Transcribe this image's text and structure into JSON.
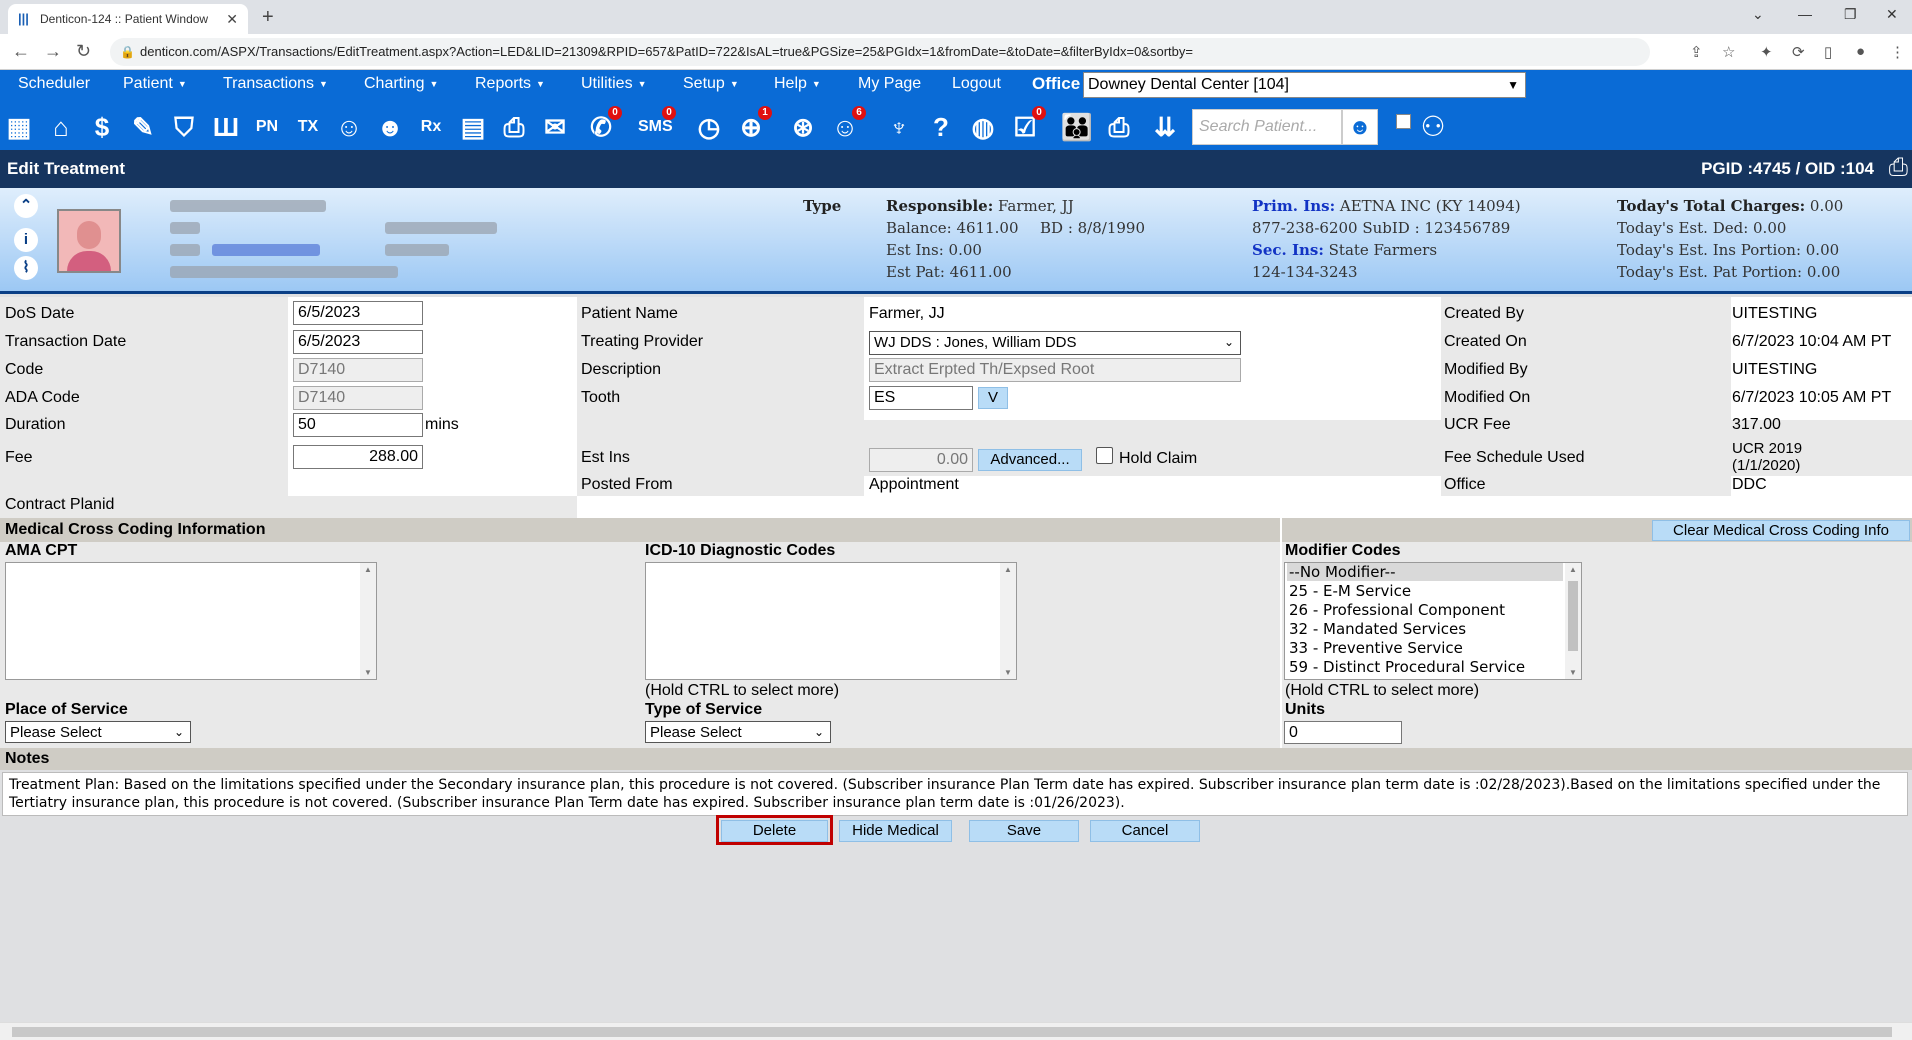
{
  "browser": {
    "tab_title": "Denticon-124 :: Patient Window",
    "url": "denticon.com/ASPX/Transactions/EditTreatment.aspx?Action=LED&LID=21309&RPID=657&PatID=722&IsAL=true&PGSize=25&PGIdx=1&fromDate=&toDate=&filterByIdx=0&sortby="
  },
  "menu": {
    "items": [
      "Scheduler",
      "Patient",
      "Transactions",
      "Charting",
      "Reports",
      "Utilities",
      "Setup",
      "Help",
      "My Page",
      "Logout"
    ],
    "office_label": "Office",
    "office_value": "Downey Dental Center [104]"
  },
  "toolbar": {
    "labels": {
      "pn": "PN",
      "tx": "TX",
      "rx": "Rx",
      "sms": "SMS"
    },
    "badges": {
      "messages": "0",
      "sms": "0",
      "alerts": "1",
      "referral": "6",
      "checklist": "0"
    },
    "search_placeholder": "Search Patient..."
  },
  "titlebar": {
    "title": "Edit Treatment",
    "ids": "PGID :4745  /  OID :104"
  },
  "banner": {
    "type_label": "Type",
    "responsible_label": "Responsible:",
    "responsible": "Farmer, JJ",
    "balance": "Balance: 4611.00",
    "bd": "BD : 8/8/1990",
    "est_ins": "Est Ins:  0.00",
    "est_pat": "Est Pat: 4611.00",
    "prim_ins_label": "Prim. Ins:",
    "prim_ins": "AETNA INC (KY 14094)",
    "prim_phone": "877-238-6200 SubID : 123456789",
    "sec_ins_label": "Sec. Ins:",
    "sec_ins": "State Farmers",
    "sec_phone": "124-134-3243",
    "total_charges_label": "Today's Total Charges:",
    "total_charges": "0.00",
    "est_ded": " Today's Est. Ded:   0.00",
    "est_ins_portion": "Today's Est. Ins Portion: 0.00",
    "est_pat_portion": "Today's Est. Pat Portion: 0.00"
  },
  "form": {
    "dos_date_label": "DoS Date",
    "dos_date": "6/5/2023",
    "transaction_date_label": "Transaction Date",
    "transaction_date": "6/5/2023",
    "code_label": "Code",
    "code": "D7140",
    "ada_code_label": "ADA Code",
    "ada_code": "D7140",
    "duration_label": "Duration",
    "duration": "50",
    "duration_unit": "mins",
    "fee_label": "Fee",
    "fee": "288.00",
    "contract_planid_label": "Contract Planid",
    "patient_name_label": "Patient Name",
    "patient_name": "Farmer, JJ",
    "treating_provider_label": "Treating Provider",
    "treating_provider": "WJ DDS : Jones, William DDS",
    "description_label": "Description",
    "description": "Extract Erpted Th/Expsed Root",
    "tooth_label": "Tooth",
    "tooth": "ES",
    "tooth_btn": "V",
    "est_ins_label": "Est Ins",
    "est_ins": "0.00",
    "advanced_btn": "Advanced...",
    "hold_claim_label": "Hold Claim",
    "posted_from_label": "Posted From",
    "posted_from": "Appointment",
    "created_by_label": "Created By",
    "created_by": "UITESTING",
    "created_on_label": "Created On",
    "created_on": "6/7/2023 10:04 AM PT",
    "modified_by_label": "Modified By",
    "modified_by": "UITESTING",
    "modified_on_label": "Modified On",
    "modified_on": "6/7/2023 10:05 AM PT",
    "ucr_fee_label": "UCR Fee",
    "ucr_fee": "317.00",
    "fee_schedule_label": "Fee Schedule Used",
    "fee_schedule_1": "UCR 2019",
    "fee_schedule_2": "(1/1/2020)",
    "office_label": "Office",
    "office": "DDC"
  },
  "medical": {
    "section_title": "Medical Cross Coding Information",
    "clear_btn": "Clear Medical Cross Coding Info",
    "ama_cpt_label": "AMA CPT",
    "icd10_label": "ICD-10 Diagnostic Codes",
    "modifier_label": "Modifier Codes",
    "modifier_options": [
      "--No Modifier--",
      "25 - E-M Service",
      "26 - Professional Component",
      "32 - Mandated Services",
      "33 - Preventive Service",
      "59 - Distinct Procedural Service"
    ],
    "ctrl_hint": "(Hold CTRL to select more)",
    "place_of_service_label": "Place of Service",
    "place_of_service": "Please Select",
    "type_of_service_label": "Type of Service",
    "type_of_service": "Please Select",
    "units_label": "Units",
    "units": "0"
  },
  "notes": {
    "label": "Notes",
    "text": "Treatment Plan:  Based on the limitations specified under the Secondary insurance plan, this procedure is not covered. (Subscriber insurance Plan Term date has expired. Subscriber insurance plan term date is :02/28/2023).Based on the limitations specified under the Tertiatry insurance plan, this procedure is not covered. (Subscriber insurance Plan Term date has expired. Subscriber insurance plan term date is :01/26/2023)."
  },
  "actions": {
    "delete": "Delete",
    "hide_medical": "Hide Medical",
    "save": "Save",
    "cancel": "Cancel"
  },
  "colors": {
    "nav_blue": "#0a6bd6",
    "title_navy": "#16355f",
    "highlight_red": "#c00000",
    "button_blue": "#b9dcf7"
  }
}
